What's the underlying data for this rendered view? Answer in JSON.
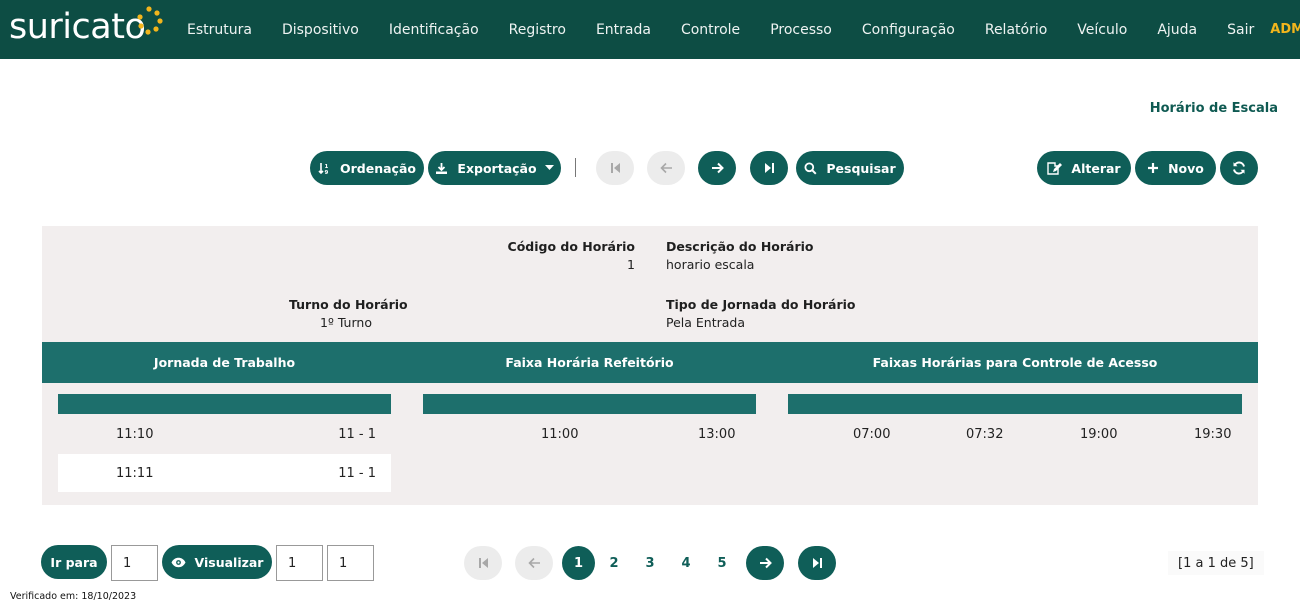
{
  "app": {
    "logo_text": "suricato"
  },
  "nav": {
    "items": [
      "Estrutura",
      "Dispositivo",
      "Identificação",
      "Registro",
      "Entrada",
      "Controle",
      "Processo",
      "Configuração",
      "Relatório",
      "Veículo",
      "Ajuda",
      "Sair"
    ],
    "user": "ADMIN"
  },
  "page": {
    "title": "Horário de Escala"
  },
  "toolbar": {
    "sort_label": "Ordenação",
    "export_label": "Exportação",
    "search_label": "Pesquisar",
    "edit_label": "Alterar",
    "new_label": "Novo"
  },
  "record": {
    "code_label": "Código do Horário",
    "code_value": "1",
    "description_label": "Descrição do Horário",
    "description_value": "horario escala",
    "shift_label": "Turno do Horário",
    "shift_value": "1º Turno",
    "journey_type_label": "Tipo de Jornada do Horário",
    "journey_type_value": "Pela Entrada"
  },
  "grids": {
    "work_journey": {
      "title": "Jornada de Trabalho",
      "rows": [
        {
          "time": "11:10",
          "range": "11 - 1"
        },
        {
          "time": "11:11",
          "range": "11 - 1"
        }
      ]
    },
    "cafeteria": {
      "title": "Faixa Horária Refeitório",
      "rows": [
        {
          "start": "11:00",
          "end": "13:00"
        }
      ]
    },
    "access": {
      "title": "Faixas Horárias para Controle de Acesso",
      "rows": [
        {
          "t1": "07:00",
          "t2": "07:32",
          "t3": "19:00",
          "t4": "19:30"
        }
      ]
    }
  },
  "footer": {
    "goto_label": "Ir para",
    "goto_value": "1",
    "view_label": "Visualizar",
    "view_from": "1",
    "view_to": "1",
    "pages": [
      "1",
      "2",
      "3",
      "4",
      "5"
    ],
    "current_page": "1",
    "counter": "[1 a 1 de 5]",
    "verified": "Verificado em: 18/10/2023"
  },
  "colors": {
    "primary": "#0f5e58",
    "header_bg": "#0d4d44",
    "grid_head": "#1d6f6c",
    "accent": "#f2b51c",
    "panel_bg": "#f2eeee"
  }
}
